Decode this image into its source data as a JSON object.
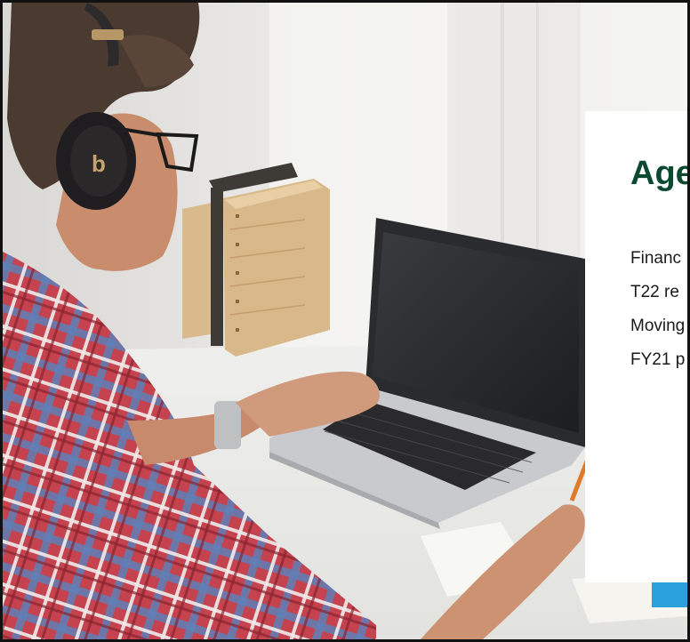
{
  "agenda": {
    "title": "Age",
    "items": [
      "Financ",
      "T22 re",
      "Moving",
      "FY21 p"
    ]
  },
  "colors": {
    "title": "#0b4a31",
    "text": "#1a1a1a",
    "frame": "#111111",
    "wall": "#ececea"
  },
  "photo": {
    "subject": "man-with-headphones-using-laptop"
  }
}
